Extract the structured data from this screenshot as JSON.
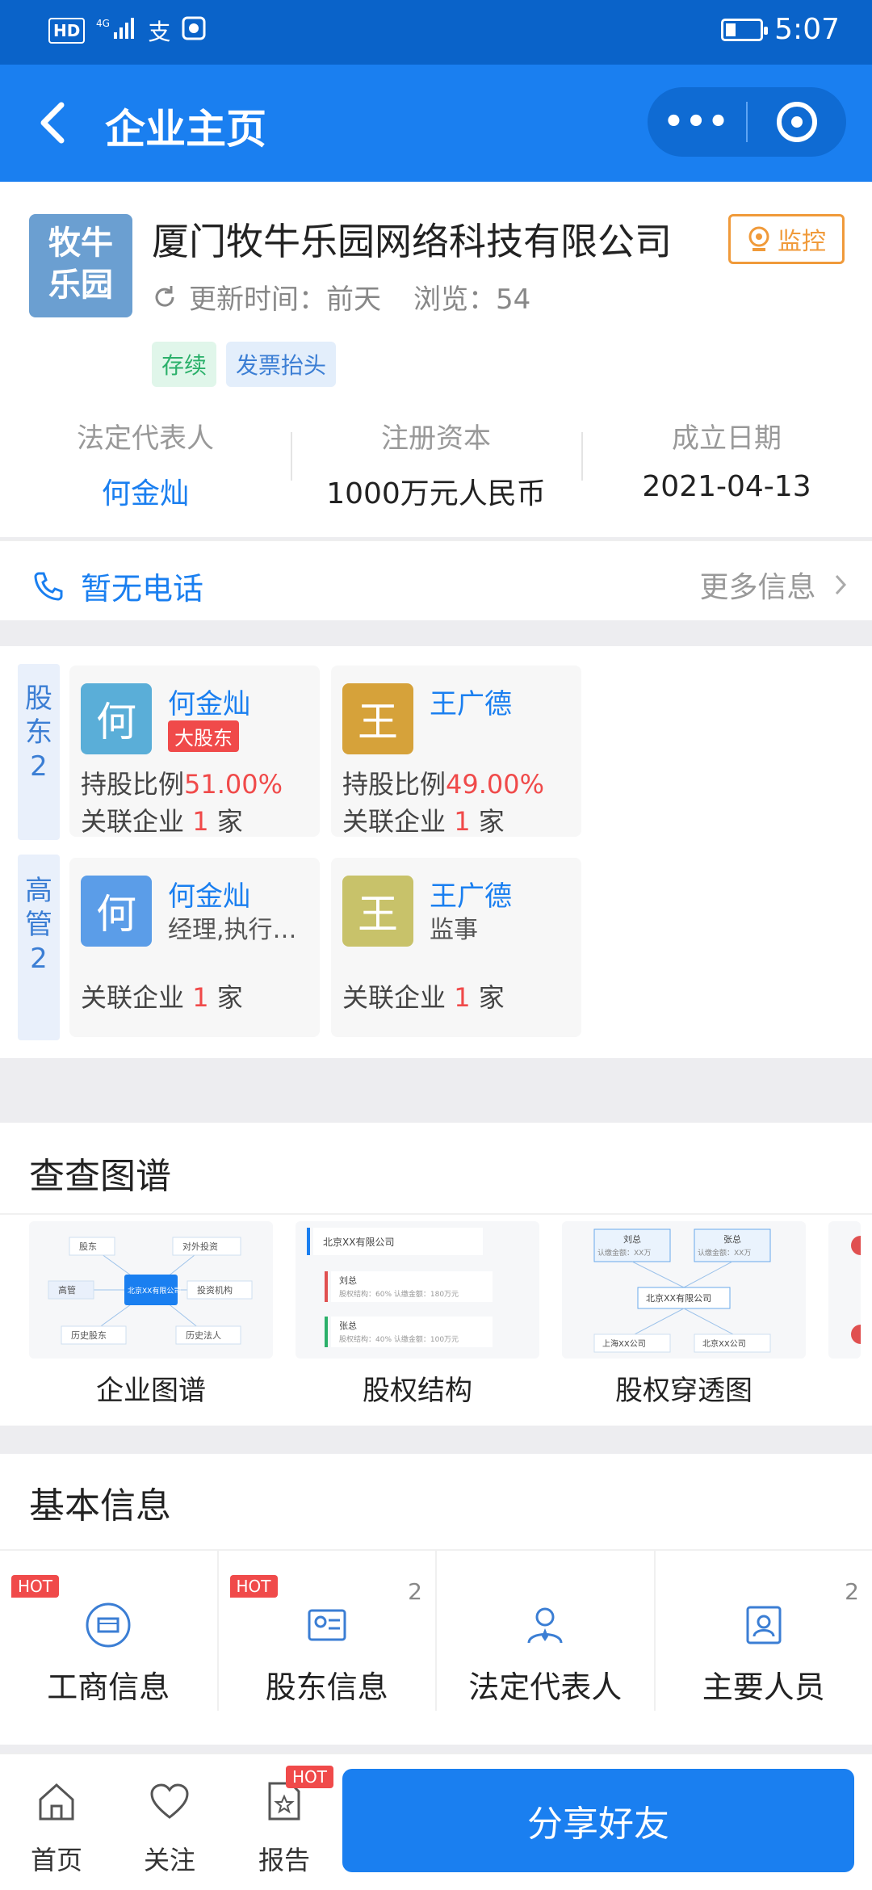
{
  "status_bar": {
    "left": "HD 4G",
    "app_icon_1": "支",
    "time": "5:07"
  },
  "navbar": {
    "title": "企业主页",
    "more": "•••"
  },
  "company": {
    "logo_line1": "牧牛",
    "logo_line2": "乐园",
    "name": "厦门牧牛乐园网络科技有限公司",
    "monitor": "监控",
    "update_label": "更新时间：前天",
    "views": "浏览：54",
    "tags": [
      "存续",
      "发票抬头"
    ],
    "facts": [
      {
        "label": "法定代表人",
        "value": "何金灿"
      },
      {
        "label": "注册资本",
        "value": "1000万元人民币"
      },
      {
        "label": "成立日期",
        "value": "2021-04-13"
      }
    ]
  },
  "phone": {
    "text": "暂无电话",
    "more": "更多信息"
  },
  "shareholders": {
    "label": "股东",
    "count": "2",
    "people": [
      {
        "avatar": "何",
        "name": "何金灿",
        "badge": "大股东",
        "ratio_label": "持股比例",
        "ratio": "51.00%",
        "rel_prefix": "关联企业",
        "rel_count": "1",
        "rel_suffix": "家",
        "color": "#5aaed8"
      },
      {
        "avatar": "王",
        "name": "王广德",
        "ratio_label": "持股比例",
        "ratio": "49.00%",
        "rel_prefix": "关联企业",
        "rel_count": "1",
        "rel_suffix": "家",
        "color": "#d6a23a"
      }
    ]
  },
  "executives": {
    "label": "高管",
    "count": "2",
    "people": [
      {
        "avatar": "何",
        "name": "何金灿",
        "role": "经理,执行董事",
        "rel_prefix": "关联企业",
        "rel_count": "1",
        "rel_suffix": "家",
        "color": "#5b9de8"
      },
      {
        "avatar": "王",
        "name": "王广德",
        "role": "监事",
        "rel_prefix": "关联企业",
        "rel_count": "1",
        "rel_suffix": "家",
        "color": "#c8c26a"
      }
    ]
  },
  "graphs": {
    "title": "查查图谱",
    "tiles": [
      {
        "name": "企业图谱",
        "center": "北京XX有限公司",
        "nodes": [
          "股东",
          "对外投资",
          "高管",
          "投资机构",
          "历史股东",
          "历史法人"
        ]
      },
      {
        "name": "股权结构",
        "top": "北京XX有限公司",
        "p1": "刘总",
        "p1_info": "股权结构：60%  认缴金额：180万元",
        "p2": "张总",
        "p2_info": "股权结构：40%  认缴金额：100万元"
      },
      {
        "name": "股权穿透图",
        "a": "刘总",
        "a_info": "认缴金额：XX万",
        "b": "张总",
        "b_info": "认缴金额：XX万",
        "center": "北京XX有限公司",
        "c": "上海XX公司",
        "d": "北京XX公司"
      }
    ]
  },
  "basic": {
    "title": "基本信息",
    "items": [
      {
        "label": "工商信息",
        "hot": "HOT",
        "count": ""
      },
      {
        "label": "股东信息",
        "hot": "HOT",
        "count": "2"
      },
      {
        "label": "法定代表人",
        "hot": "",
        "count": ""
      },
      {
        "label": "主要人员",
        "hot": "",
        "count": "2"
      }
    ]
  },
  "tabbar": {
    "home": "首页",
    "follow": "关注",
    "report": "报告",
    "report_hot": "HOT",
    "share": "分享好友"
  },
  "colors": {
    "brand": "#1a7ff0",
    "status_bar": "#0a63c9",
    "hot": "#f04a4a",
    "monitor": "#f09a3a"
  }
}
